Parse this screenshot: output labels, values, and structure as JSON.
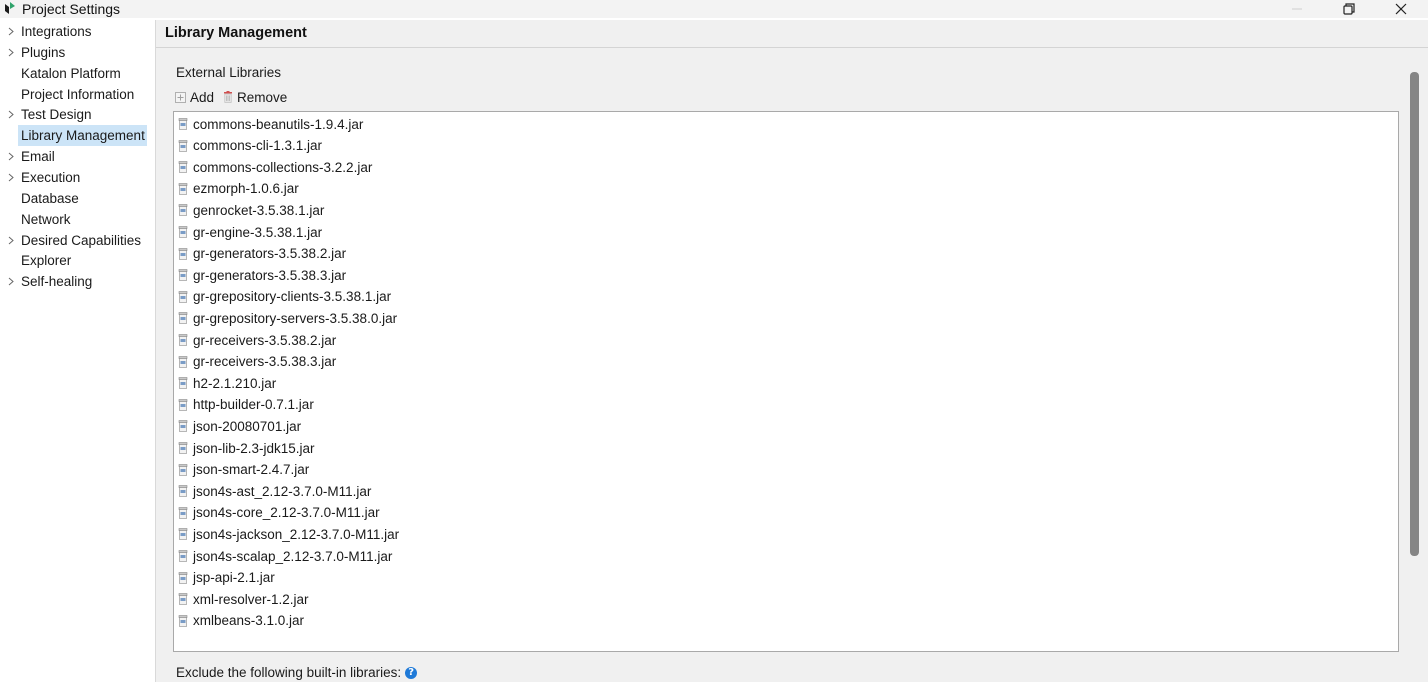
{
  "window": {
    "title": "Project Settings"
  },
  "sidebar": {
    "items": [
      {
        "label": "Integrations",
        "expandable": true
      },
      {
        "label": "Plugins",
        "expandable": true
      },
      {
        "label": "Katalon Platform",
        "expandable": false
      },
      {
        "label": "Project Information",
        "expandable": false
      },
      {
        "label": "Test Design",
        "expandable": true
      },
      {
        "label": "Library Management",
        "expandable": false,
        "selected": true
      },
      {
        "label": "Email",
        "expandable": true
      },
      {
        "label": "Execution",
        "expandable": true
      },
      {
        "label": "Database",
        "expandable": false
      },
      {
        "label": "Network",
        "expandable": false
      },
      {
        "label": "Desired Capabilities",
        "expandable": true
      },
      {
        "label": "Explorer",
        "expandable": false
      },
      {
        "label": "Self-healing",
        "expandable": true
      }
    ]
  },
  "main": {
    "title": "Library Management",
    "external_label": "External Libraries",
    "toolbar": {
      "add_label": "Add",
      "remove_label": "Remove"
    },
    "libraries": [
      "commons-beanutils-1.9.4.jar",
      "commons-cli-1.3.1.jar",
      "commons-collections-3.2.2.jar",
      "ezmorph-1.0.6.jar",
      "genrocket-3.5.38.1.jar",
      "gr-engine-3.5.38.1.jar",
      "gr-generators-3.5.38.2.jar",
      "gr-generators-3.5.38.3.jar",
      "gr-grepository-clients-3.5.38.1.jar",
      "gr-grepository-servers-3.5.38.0.jar",
      "gr-receivers-3.5.38.2.jar",
      "gr-receivers-3.5.38.3.jar",
      "h2-2.1.210.jar",
      "http-builder-0.7.1.jar",
      "json-20080701.jar",
      "json-lib-2.3-jdk15.jar",
      "json-smart-2.4.7.jar",
      "json4s-ast_2.12-3.7.0-M11.jar",
      "json4s-core_2.12-3.7.0-M11.jar",
      "json4s-jackson_2.12-3.7.0-M11.jar",
      "json4s-scalap_2.12-3.7.0-M11.jar",
      "jsp-api-2.1.jar",
      "xml-resolver-1.2.jar",
      "xmlbeans-3.1.0.jar"
    ],
    "exclude_label": "Exclude the following built-in libraries:",
    "help_glyph": "?"
  },
  "colors": {
    "selection": "#cce4f7",
    "help_icon": "#1f7ad8",
    "app_icon": "#2fa36b"
  }
}
